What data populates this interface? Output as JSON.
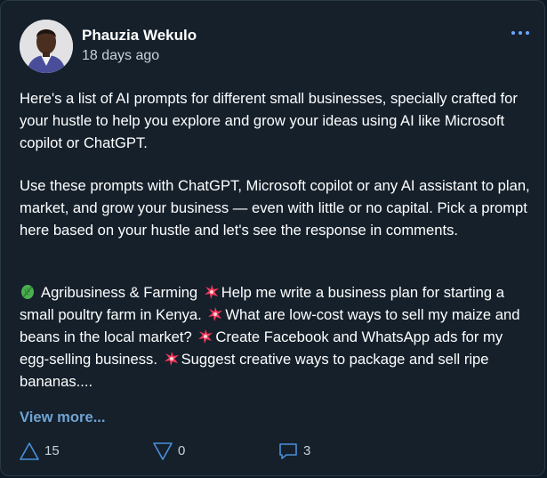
{
  "post": {
    "author": "Phauzia Wekulo",
    "timestamp": "18 days ago",
    "intro": "Here's a list of AI prompts for different small businesses, specially crafted for your hustle to help you explore and grow your ideas using AI like Microsoft copilot or ChatGPT.",
    "usage": "Use these prompts with ChatGPT, Microsoft copilot or any AI assistant to plan, market, and grow your business — even with little or no capital. Pick a prompt here based on your hustle and let's see the response in comments.",
    "category": "Agribusiness & Farming",
    "prompts": [
      "Help me write a business plan for starting a small poultry farm in Kenya.",
      "What are low-cost ways to sell my maize and beans in the local market?",
      "Create Facebook and WhatsApp ads for my egg-selling business.",
      "Suggest creative ways to package and sell ripe bananas...."
    ],
    "view_more": "View more...",
    "upvotes": "15",
    "downvotes": "0",
    "comments": "3"
  },
  "icons": {
    "more": "more-horizontal-icon",
    "category": "leafy-green-emoji",
    "bullet": "collision-sparkle-emoji",
    "upvote": "triangle-up-icon",
    "downvote": "triangle-down-icon",
    "comment": "speech-bubble-icon"
  },
  "colors": {
    "background": "#15202b",
    "text": "#ffffff",
    "muted": "#c8d1d9",
    "link": "#6fa3d2",
    "accent": "#6aa8ff",
    "icon": "#4a8fd9"
  }
}
